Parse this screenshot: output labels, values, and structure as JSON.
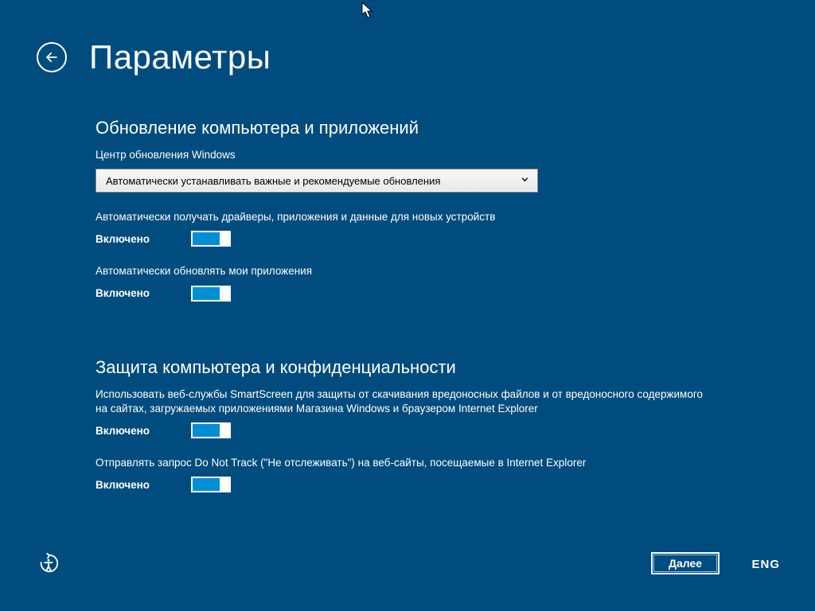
{
  "header": {
    "title": "Параметры"
  },
  "section_updates": {
    "heading": "Обновление компьютера и приложений",
    "wu_label": "Центр обновления Windows",
    "wu_selected": "Автоматически устанавливать важные и рекомендуемые обновления",
    "drivers_label": "Автоматически получать драйверы, приложения и данные для новых устройств",
    "drivers_state": "Включено",
    "apps_label": "Автоматически обновлять мои приложения",
    "apps_state": "Включено"
  },
  "section_privacy": {
    "heading": "Защита компьютера и конфиденциальности",
    "smartscreen_label": "Использовать веб-службы SmartScreen для защиты от скачивания вредоносных файлов и от вредоносного содержимого на сайтах, загружаемых приложениями Магазина Windows и браузером Internet Explorer",
    "smartscreen_state": "Включено",
    "dnt_label": "Отправлять запрос Do Not Track (\"Не отслеживать\") на веб-сайты, посещаемые в Internet Explorer",
    "dnt_state": "Включено"
  },
  "footer": {
    "next": "Далее",
    "lang": "ENG"
  }
}
